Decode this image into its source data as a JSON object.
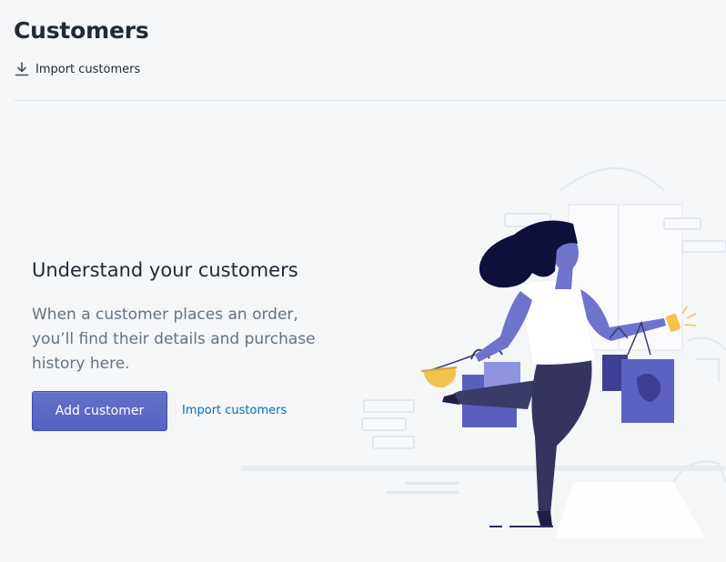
{
  "header": {
    "title": "Customers",
    "import_action": {
      "label": "Import customers",
      "icon": "import-icon"
    }
  },
  "empty_state": {
    "heading": "Understand your customers",
    "text": "When a customer places an order, you’ll find their details and purchase history here.",
    "primary_action": "Add customer",
    "secondary_action": "Import customers",
    "illustration": "shopping-woman-illustration"
  },
  "colors": {
    "background": "#f4f6f8",
    "primary": "#5c6ac4",
    "link": "#006fbb",
    "illustration_purple": "#6e73cc",
    "illustration_dark": "#2e2d5a",
    "accent_yellow": "#f3c24d"
  }
}
